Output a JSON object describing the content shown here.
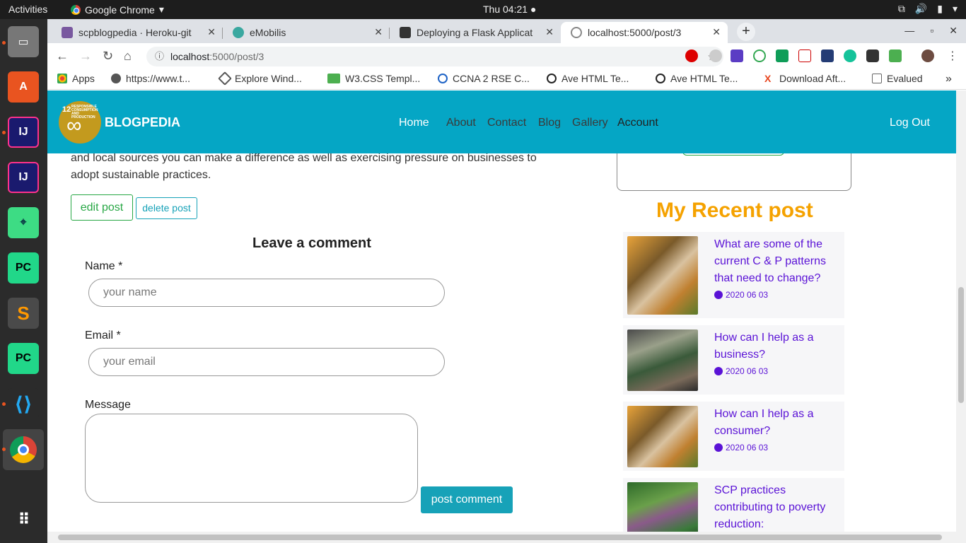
{
  "os": {
    "activities": "Activities",
    "app_name": "Google Chrome",
    "clock": "Thu 04:21 ●"
  },
  "browser": {
    "tabs": [
      {
        "label": "scpblogpedia · Heroku-git",
        "favicon_color": "#79589f"
      },
      {
        "label": "eMobilis",
        "favicon_color": "#3aa8a0"
      },
      {
        "label": "Deploying a Flask Applicat",
        "favicon_color": "#333333"
      },
      {
        "label": "localhost:5000/post/3",
        "favicon_color": "#888888"
      }
    ],
    "new_tab": "+",
    "close": "✕",
    "url_host": "localhost",
    "url_path": ":5000/post/3",
    "bookmarks": [
      {
        "label": "Apps",
        "color": "#e94235"
      },
      {
        "label": "https://www.t...",
        "color": "#555555"
      },
      {
        "label": "Explore Wind...",
        "color": "#555555"
      },
      {
        "label": "W3.CSS Templ...",
        "color": "#4caf50"
      },
      {
        "label": "CCNA 2 RSE C...",
        "color": "#1e63c6"
      },
      {
        "label": "Ave HTML Te...",
        "color": "#222222"
      },
      {
        "label": "Ave HTML Te...",
        "color": "#222222"
      },
      {
        "label": "Download Aft...",
        "color": "#e8451e"
      },
      {
        "label": "Evalued",
        "color": "#666666"
      }
    ],
    "more_bookmarks": "»"
  },
  "site": {
    "brand": "BLOGPEDIA",
    "logo_number": "12",
    "logo_text": "RESPONSIBLE CONSUMPTION AND PRODUCTION",
    "menu": [
      "Home",
      "About",
      "Contact",
      "Blog",
      "Gallery",
      "Account"
    ],
    "logout": "Log Out",
    "accent_color": "#05a6c5"
  },
  "post": {
    "body": "and local sources you can make a difference as well as exercising pressure on businesses to adopt sustainable practices.",
    "edit_label": "edit post",
    "delete_label": "delete post"
  },
  "comment_form": {
    "title": "Leave a comment",
    "name_label": "Name *",
    "name_placeholder": "your name",
    "email_label": "Email *",
    "email_placeholder": "your email",
    "message_label": "Message",
    "submit_label": "post comment"
  },
  "sidebar": {
    "recent_title": "My Recent post",
    "posts": [
      {
        "title": "What are some of the current C & P patterns that need to change?",
        "date": "2020 06 03"
      },
      {
        "title": "How can I help as a business?",
        "date": "2020 06 03"
      },
      {
        "title": "How can I help as a consumer?",
        "date": "2020 06 03"
      },
      {
        "title": "SCP practices contributing to poverty reduction:",
        "date": ""
      }
    ]
  }
}
